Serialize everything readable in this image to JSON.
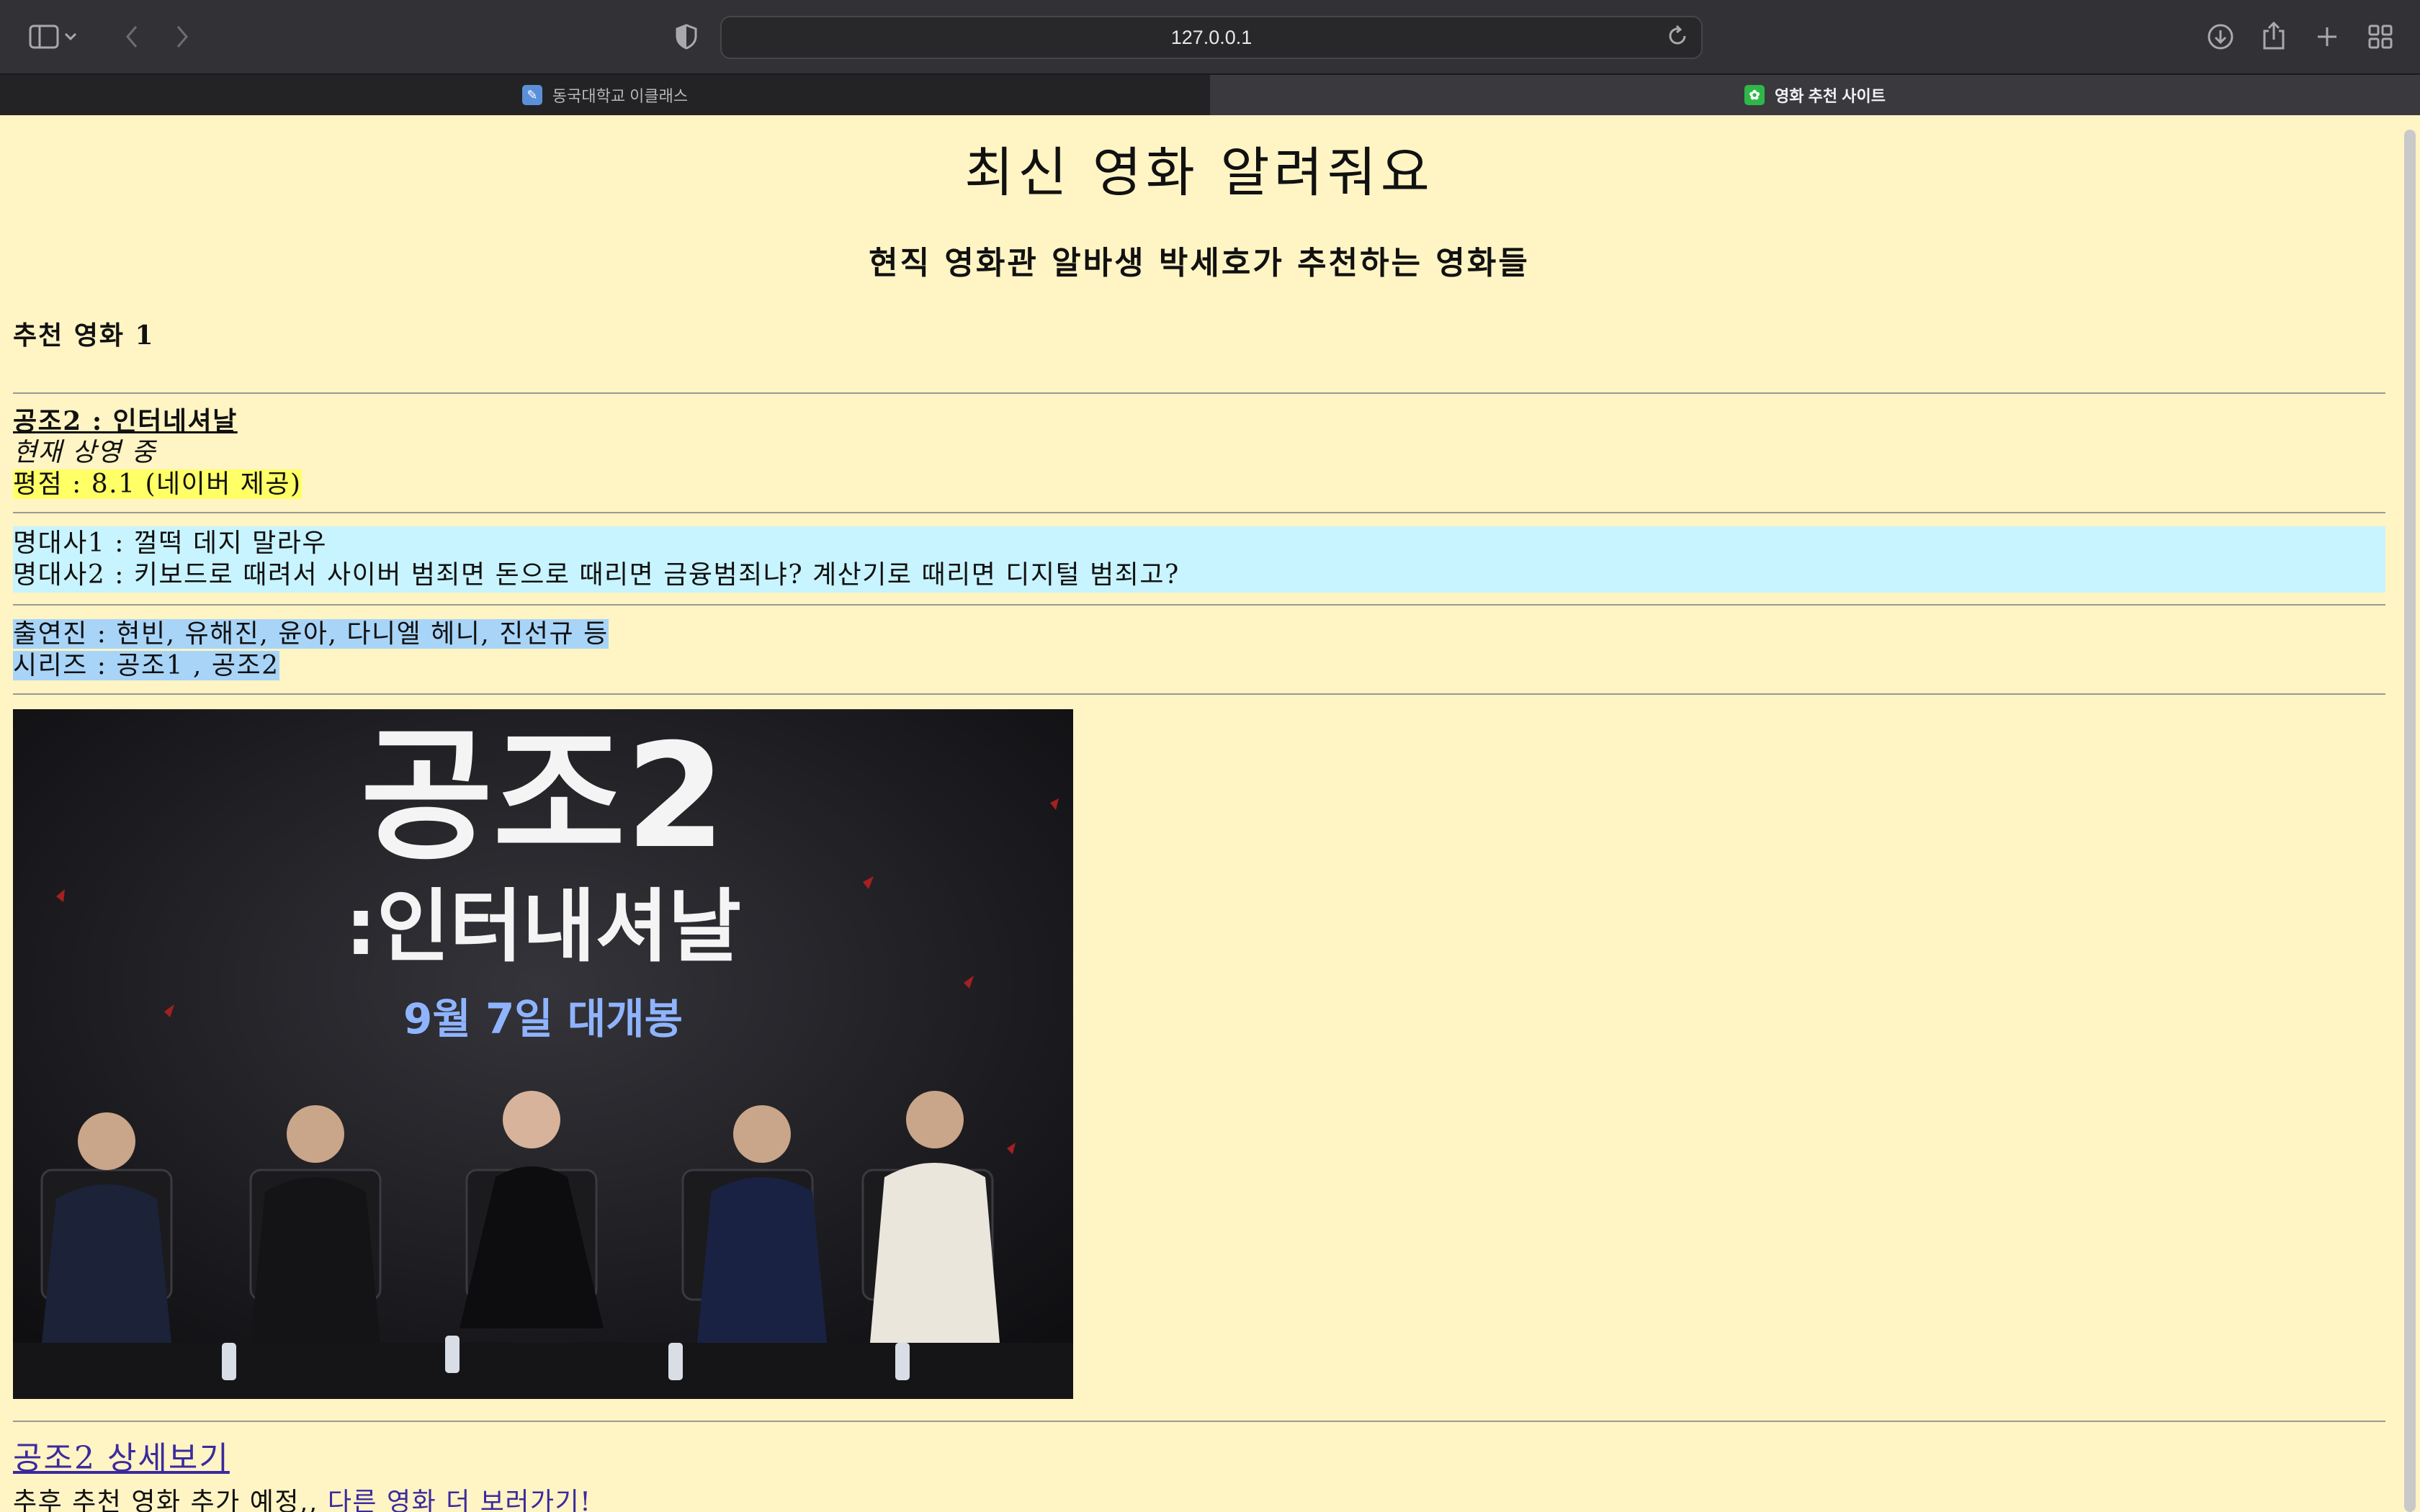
{
  "browser": {
    "url": "127.0.0.1",
    "tabs": [
      {
        "label": "동국대학교 이클래스",
        "active": false
      },
      {
        "label": "영화 추천 사이트",
        "active": true
      }
    ],
    "icons": [
      "sidebar-icon",
      "chevron-down-icon",
      "back-icon",
      "forward-icon",
      "shield-icon",
      "reload-icon",
      "download-icon",
      "share-icon",
      "plus-icon",
      "tabs-overview-icon"
    ]
  },
  "page": {
    "title": "최신 영화 알려줘요",
    "subtitle": "현직 영화관 알바생 박세호가 추천하는 영화들",
    "section_heading": "추천 영화 1",
    "movie": {
      "title": "공조2 : 인터네셔날",
      "status": "현재 상영 중",
      "rating": "평점 : 8.1 (네이버 제공)",
      "quotes": [
        "명대사1 : 껄떡 데지 말라우",
        "명대사2 : 키보드로 때려서 사이버 범죄면 돈으로 때리면 금융범죄냐? 계산기로 때리면 디지털 범죄고?"
      ],
      "cast": "출연진 : 현빈, 유해진, 윤아, 다니엘 헤니, 진선규 등",
      "series": "시리즈 : 공조1 , 공조2",
      "poster": {
        "title_line1": "공조2",
        "title_line2": ":인터내셔날",
        "release": "9월 7일 대개봉"
      },
      "detail_link": "공조2 상세보기"
    },
    "footer_text": "추후 추천 영화 추가 예정,, ",
    "more_link": "다른 영화 더 보러가기!"
  },
  "colors": {
    "page_bg": "#fff4c4",
    "rating_highlight": "#ffff66",
    "quotes_bg": "#c8f4ff",
    "cast_highlight": "#a8d4f8",
    "link": "#3b2a9e"
  }
}
